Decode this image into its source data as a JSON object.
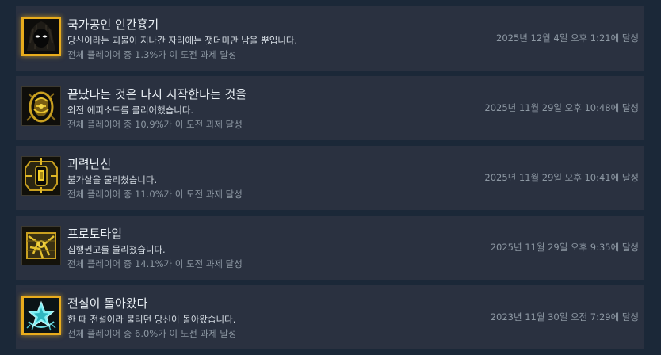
{
  "achievements": [
    {
      "title": "국가공인 인간흉기",
      "description": "당신이라는 괴물이 지나간 자리에는 잿더미만 남을 뿐입니다.",
      "percent_text": "전체 플레이어 중 1.3%가 이 도전 과제 달성",
      "unlock_text": "2025년 12월 4일 오후 1:21에 달성",
      "icon": "dark-mask-face-icon"
    },
    {
      "title": "끝났다는 것은 다시 시작한다는 것을",
      "description": "외전 에피소드를 클리어했습니다.",
      "percent_text": "전체 플레이어 중 10.9%가 이 도전 과제 달성",
      "unlock_text": "2025년 11월 29일 오후 10:48에 달성",
      "icon": "gold-egg-emblem-icon"
    },
    {
      "title": "괴력난신",
      "description": "불가살을 물리쳤습니다.",
      "percent_text": "전체 플레이어 중 11.0%가 이 도전 과제 달성",
      "unlock_text": "2025년 11월 29일 오후 10:41에 달성",
      "icon": "gold-chip-emblem-icon"
    },
    {
      "title": "프로토타입",
      "description": "집행권고를 물리쳤습니다.",
      "percent_text": "전체 플레이어 중 14.1%가 이 도전 과제 달성",
      "unlock_text": "2025년 11월 29일 오후 9:35에 달성",
      "icon": "gold-machine-emblem-icon"
    },
    {
      "title": "전설이 돌아왔다",
      "description": "한 때 전설이라 불리던 당신이 돌아왔습니다.",
      "percent_text": "전체 플레이어 중 6.0%가 이 도전 과제 달성",
      "unlock_text": "2023년 11월 30일 오전 7:29에 달성",
      "icon": "cyan-star-emblem-icon"
    }
  ],
  "colors": {
    "background": "#1b2838",
    "row": "#2a3140",
    "gold_border": "#e8ac1d",
    "title_text": "#e8eef3",
    "muted_text": "#8d98a3",
    "cyan_star": "#55e0e6"
  }
}
